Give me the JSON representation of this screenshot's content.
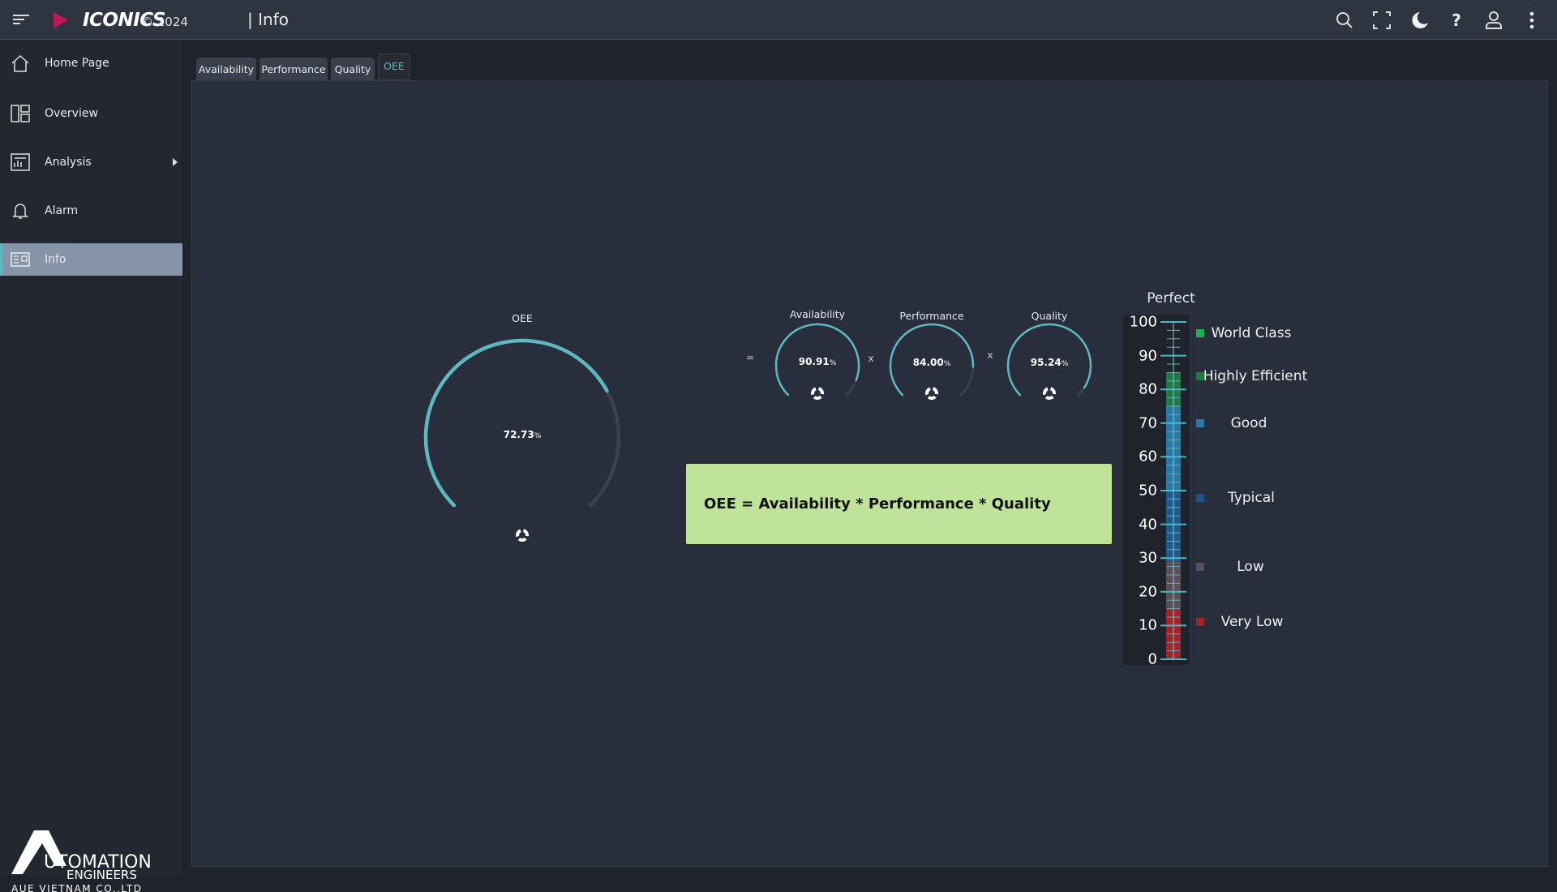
{
  "header": {
    "brand": "ICONICS",
    "copyright": "© 2024",
    "page_title": "| Info",
    "icons": [
      "menu-icon",
      "search-icon",
      "fullscreen-icon",
      "dark-mode-icon",
      "help-icon",
      "user-icon",
      "more-vert-icon"
    ]
  },
  "sidebar": {
    "items": [
      {
        "label": "Home Page",
        "icon": "home-icon"
      },
      {
        "label": "Overview",
        "icon": "overview-icon"
      },
      {
        "label": "Analysis",
        "icon": "analysis-icon",
        "has_submenu": true
      },
      {
        "label": "Alarm",
        "icon": "bell-icon"
      },
      {
        "label": "Info",
        "icon": "info-icon",
        "selected": true
      }
    ],
    "logo": {
      "line1": "AUTOMATION",
      "line2": "ENGINEERS",
      "line3": "AUE VIETNAM CO.,LTD"
    }
  },
  "tabs": [
    {
      "label": "Availability"
    },
    {
      "label": "Performance"
    },
    {
      "label": "Quality"
    },
    {
      "label": "OEE",
      "active": true
    }
  ],
  "colors": {
    "accent": "#5fb8c0",
    "track": "#3c424d",
    "formula_bg": "#bfe399"
  },
  "main_gauge": {
    "label": "OEE",
    "value": "72.73",
    "unit": "%",
    "percent": 72.73
  },
  "gauges": [
    {
      "label": "Availability",
      "value": "90.91",
      "unit": "%",
      "percent": 90.91
    },
    {
      "label": "Performance",
      "value": "84.00",
      "unit": "%",
      "percent": 84.0
    },
    {
      "label": "Quality",
      "value": "95.24",
      "unit": "%",
      "percent": 95.24
    }
  ],
  "operators": [
    "=",
    "x",
    "x"
  ],
  "formula": "OEE = Availability * Performance * Quality",
  "scale": {
    "title": "Perfect",
    "ticks": [
      "100",
      "90",
      "80",
      "70",
      "60",
      "50",
      "40",
      "30",
      "20",
      "10",
      "0"
    ],
    "bands": [
      {
        "from": 0,
        "to": 15,
        "color": "#a0242a"
      },
      {
        "from": 15,
        "to": 29,
        "color": "#5a5058"
      },
      {
        "from": 29,
        "to": 50,
        "color": "#1e5a8c"
      },
      {
        "from": 50,
        "to": 75,
        "color": "#2878a8"
      },
      {
        "from": 75,
        "to": 85,
        "color": "#1f7a45"
      }
    ],
    "legend": [
      {
        "label": "World Class",
        "color": "#1fae55"
      },
      {
        "label": "Highly Efficient",
        "color": "#1e7a44"
      },
      {
        "label": "Good",
        "color": "#2a79a6"
      },
      {
        "label": "Typical",
        "color": "#1e5588"
      },
      {
        "label": "Low",
        "color": "#5a5058"
      },
      {
        "label": "Very Low",
        "color": "#a0242a"
      }
    ]
  }
}
